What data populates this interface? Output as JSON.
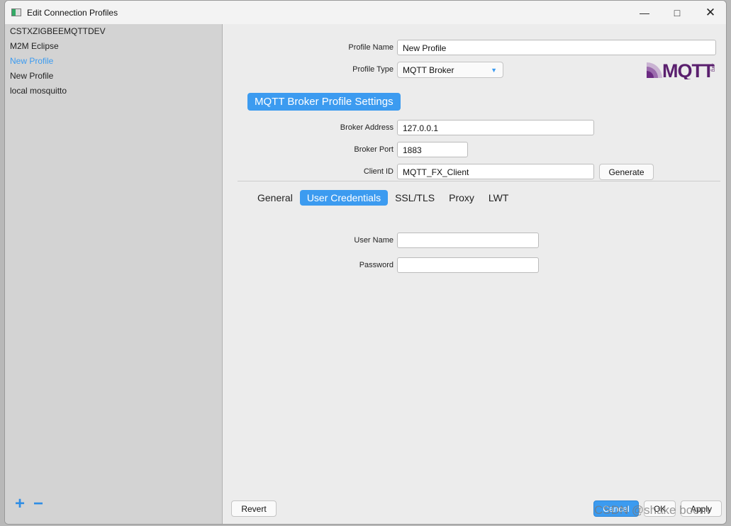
{
  "window": {
    "title": "Edit Connection Profiles"
  },
  "sidebar": {
    "items": [
      {
        "label": "CSTXZIGBEEMQTTDEV",
        "selected": false
      },
      {
        "label": "M2M Eclipse",
        "selected": false
      },
      {
        "label": "New Profile",
        "selected": true
      },
      {
        "label": "New Profile",
        "selected": false
      },
      {
        "label": "local mosquitto",
        "selected": false
      }
    ],
    "add_label": "+",
    "remove_label": "−"
  },
  "form": {
    "profile_name_label": "Profile Name",
    "profile_name": "New Profile",
    "profile_type_label": "Profile Type",
    "profile_type": "MQTT Broker",
    "logo_text": "MQTT",
    "logo_suffix": ".org",
    "section_title": "MQTT Broker Profile Settings",
    "broker_address_label": "Broker Address",
    "broker_address": "127.0.0.1",
    "broker_port_label": "Broker Port",
    "broker_port": "1883",
    "client_id_label": "Client ID",
    "client_id": "MQTT_FX_Client",
    "generate_label": "Generate"
  },
  "tabs": [
    {
      "label": "General"
    },
    {
      "label": "User Credentials",
      "active": true
    },
    {
      "label": "SSL/TLS"
    },
    {
      "label": "Proxy"
    },
    {
      "label": "LWT"
    }
  ],
  "credentials": {
    "user_name_label": "User Name",
    "user_name": "",
    "password_label": "Password",
    "password": ""
  },
  "footer": {
    "revert": "Revert",
    "cancel": "Cancel",
    "ok": "OK",
    "apply": "Apply"
  },
  "watermark": "CSDN @shake boom",
  "colors": {
    "accent": "#3c9bf0",
    "logo": "#5a1f6e"
  }
}
